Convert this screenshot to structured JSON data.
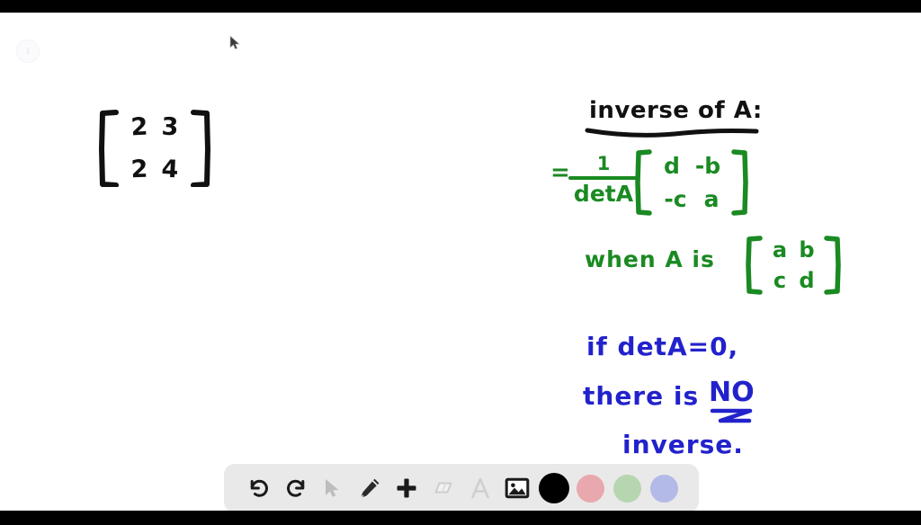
{
  "app": {
    "canvas_background": "#ffffff",
    "letterbox_color": "#000000",
    "corner_badge_label": "i"
  },
  "ink_colors": {
    "black": "#111111",
    "green": "#1a8a22",
    "blue": "#2222cc"
  },
  "whiteboard": {
    "problem_matrix": {
      "name": "problem-matrix",
      "color": "#111111",
      "rows": [
        [
          "2",
          "3"
        ],
        [
          "2",
          "4"
        ]
      ]
    },
    "heading": {
      "text": "inverse of A:",
      "color": "#111111",
      "underlined": true
    },
    "inverse_formula": {
      "equals": "=",
      "numerator": "1",
      "denominator": "detA",
      "matrix_rows": [
        [
          "d",
          "-b"
        ],
        [
          "-c",
          "a"
        ]
      ],
      "color": "#1a8a22"
    },
    "when_clause": {
      "text": "when A is",
      "matrix_rows": [
        [
          "a",
          "b"
        ],
        [
          "c",
          "d"
        ]
      ],
      "color": "#1a8a22"
    },
    "note": {
      "line1": "if detA=0,",
      "line2_prefix": "there is",
      "line2_emphasis": "NO",
      "line3": "inverse.",
      "color": "#2222cc",
      "emphasis_underlined": true
    }
  },
  "toolbar": {
    "background": "#e9e9e9",
    "tools": [
      {
        "name": "undo-button",
        "icon": "undo-icon",
        "label": "Undo",
        "state": "enabled"
      },
      {
        "name": "redo-button",
        "icon": "redo-icon",
        "label": "Redo",
        "state": "enabled"
      },
      {
        "name": "select-button",
        "icon": "cursor-icon",
        "label": "Select",
        "state": "disabled"
      },
      {
        "name": "pen-button",
        "icon": "pencil-icon",
        "label": "Pen",
        "state": "enabled"
      },
      {
        "name": "add-button",
        "icon": "plus-icon",
        "label": "Add page",
        "state": "enabled"
      },
      {
        "name": "eraser-button",
        "icon": "eraser-icon",
        "label": "Eraser",
        "state": "disabled"
      },
      {
        "name": "text-button",
        "icon": "text-a-icon",
        "label": "Text",
        "state": "disabled"
      },
      {
        "name": "image-button",
        "icon": "image-icon",
        "label": "Insert image",
        "state": "enabled"
      }
    ],
    "colors": [
      {
        "name": "color-swatch-black",
        "label": "Black",
        "hex": "#000000",
        "selected": true,
        "size": 34
      },
      {
        "name": "color-swatch-pink",
        "label": "Pink",
        "hex": "#e9a8ad",
        "selected": false,
        "size": 30
      },
      {
        "name": "color-swatch-green",
        "label": "Green",
        "hex": "#b6d6b0",
        "selected": false,
        "size": 30
      },
      {
        "name": "color-swatch-blue",
        "label": "Blue",
        "hex": "#b3bae8",
        "selected": false,
        "size": 30
      }
    ]
  }
}
